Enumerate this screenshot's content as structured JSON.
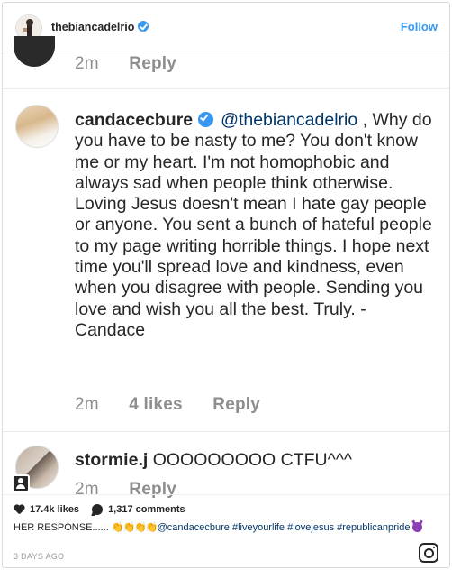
{
  "header": {
    "username": "thebiancadelrio",
    "follow_label": "Follow"
  },
  "comments": [
    {
      "time": "2m",
      "reply_label": "Reply"
    },
    {
      "username": "candacecbure",
      "mention": "@thebiancadelrio",
      "text": " , Why do you have to be nasty to me? You don't know me or my heart. I'm not homophobic and always sad when people think otherwise. Loving Jesus doesn't mean I hate gay people or anyone.  You sent a bunch of hateful people to my page writing horrible things. I hope next time you'll spread love and kindness, even when you disagree with people. Sending you love and wish you all the best. Truly. - Candace",
      "time": "2m",
      "likes": "4 likes",
      "reply_label": "Reply"
    },
    {
      "username": "stormie.j",
      "text": "OOOOOOOOO CTFU^^^",
      "time": "2m",
      "reply_label": "Reply"
    }
  ],
  "footer": {
    "likes": "17.4k likes",
    "comments": "1,317 comments",
    "caption_start": "HER RESPONSE......",
    "claps": "👏👏👏👏",
    "caption_mention": "@candacecbure",
    "hashtags": "#liveyourlife #lovejesus #republicanpride",
    "date": "3 DAYS AGO"
  }
}
